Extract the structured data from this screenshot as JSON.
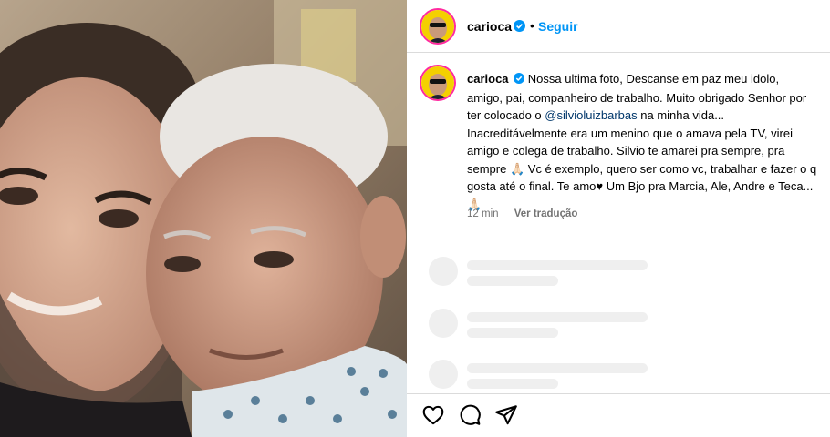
{
  "post": {
    "photo_alt": "Selfie of two men",
    "author": {
      "username": "carioca",
      "verified": true,
      "follow_label": "Seguir",
      "separator": "•"
    },
    "caption": {
      "username": "carioca",
      "text_part1": "Nossa ultima foto, Descanse em paz meu idolo, amigo, pai, companheiro de trabalho. Muito obrigado Senhor por ter colocado o ",
      "mention": "@silvioluizbarbas",
      "text_part2": " na minha vida... Inacreditávelmente era um menino que o amava pela TV, virei amigo e colega de trabalho. Silvio te amarei pra sempre, pra sempre ",
      "emoji1": "🙏🏻",
      "text_part3": " Vc é exemplo, quero ser como vc, trabalhar e fazer o q gosta até o final. Te amo♥ Um Bjo pra Marcia, Ale, Andre e Teca... ",
      "emoji2": "🙏🏻"
    },
    "meta": {
      "time": "12 min",
      "translate_label": "Ver tradução"
    },
    "actions": [
      "heart-icon",
      "comment-icon",
      "share-icon"
    ]
  },
  "colors": {
    "link_blue": "#0095f6",
    "mention_blue": "#00376b",
    "secondary_text": "#737373",
    "skeleton": "#efefef",
    "divider": "#dbdbdb"
  }
}
